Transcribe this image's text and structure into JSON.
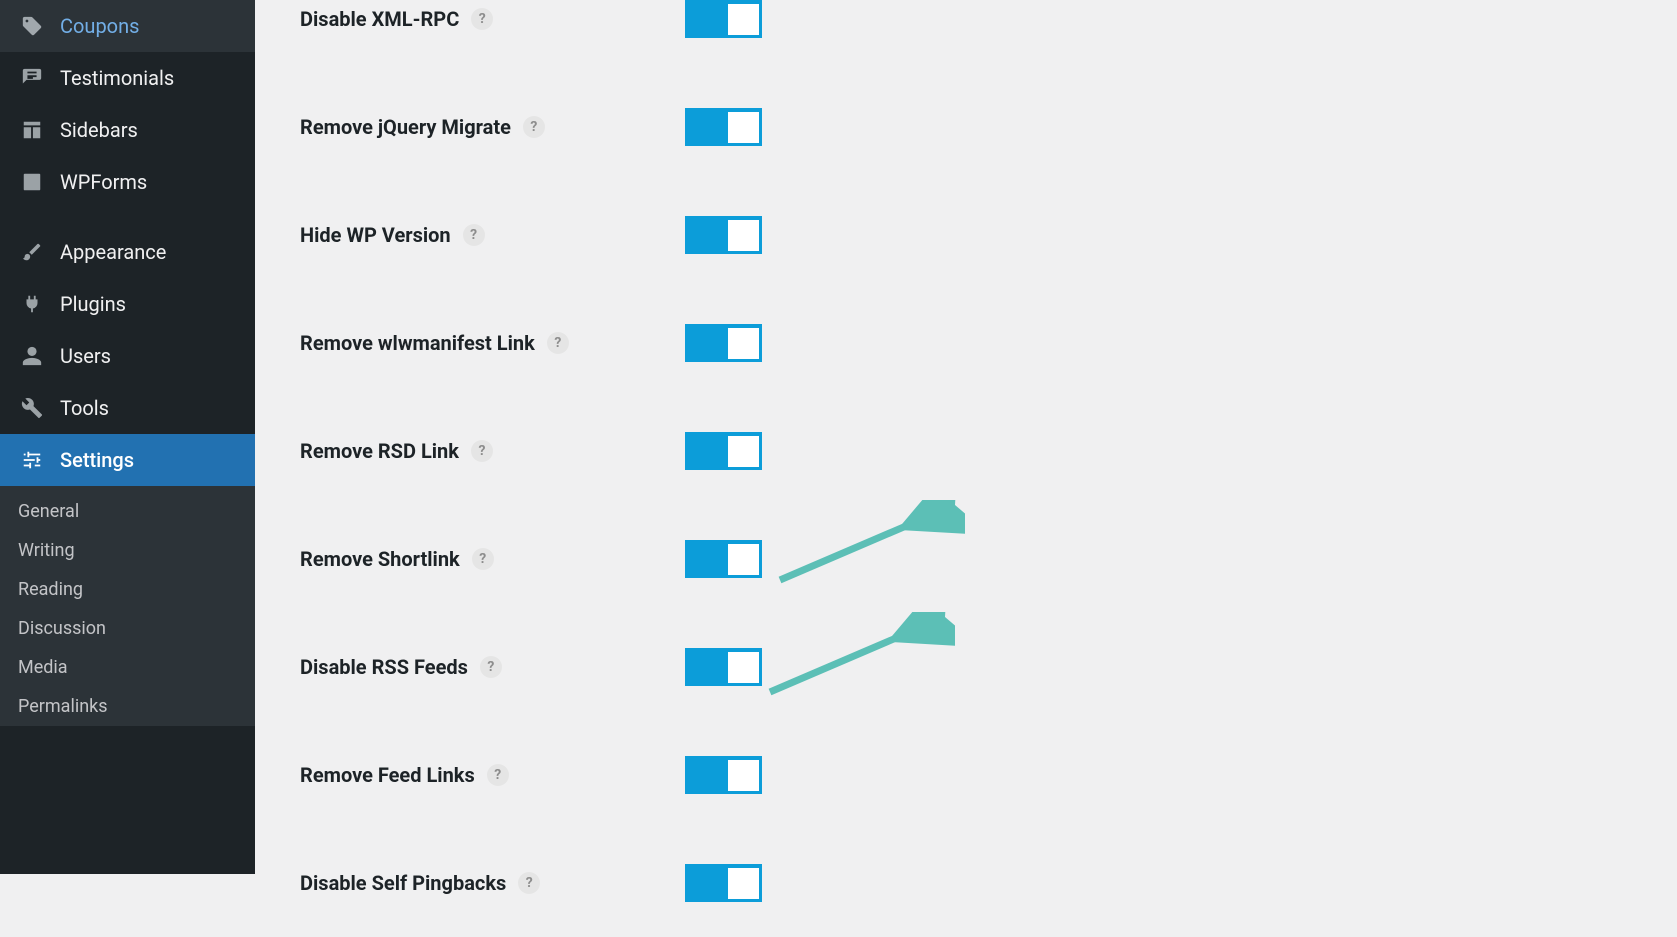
{
  "sidebar": {
    "primary": [
      {
        "label": "Coupons",
        "icon": "tag"
      },
      {
        "label": "Testimonials",
        "icon": "testimonial"
      },
      {
        "label": "Sidebars",
        "icon": "table"
      },
      {
        "label": "WPForms",
        "icon": "wpforms"
      }
    ],
    "secondary": [
      {
        "label": "Appearance",
        "icon": "brush"
      },
      {
        "label": "Plugins",
        "icon": "plug"
      },
      {
        "label": "Users",
        "icon": "user"
      },
      {
        "label": "Tools",
        "icon": "wrench"
      },
      {
        "label": "Settings",
        "icon": "sliders",
        "active": true
      }
    ],
    "submenu": [
      "General",
      "Writing",
      "Reading",
      "Discussion",
      "Media",
      "Permalinks"
    ]
  },
  "settings": [
    {
      "label": "Disable XML-RPC",
      "on": true
    },
    {
      "label": "Remove jQuery Migrate",
      "on": true
    },
    {
      "label": "Hide WP Version",
      "on": true
    },
    {
      "label": "Remove wlwmanifest Link",
      "on": true
    },
    {
      "label": "Remove RSD Link",
      "on": true
    },
    {
      "label": "Remove Shortlink",
      "on": true
    },
    {
      "label": "Disable RSS Feeds",
      "on": true
    },
    {
      "label": "Remove Feed Links",
      "on": true
    },
    {
      "label": "Disable Self Pingbacks",
      "on": true
    }
  ],
  "help_symbol": "?",
  "annotations": {
    "arrow_color": "#5cbfb6"
  }
}
